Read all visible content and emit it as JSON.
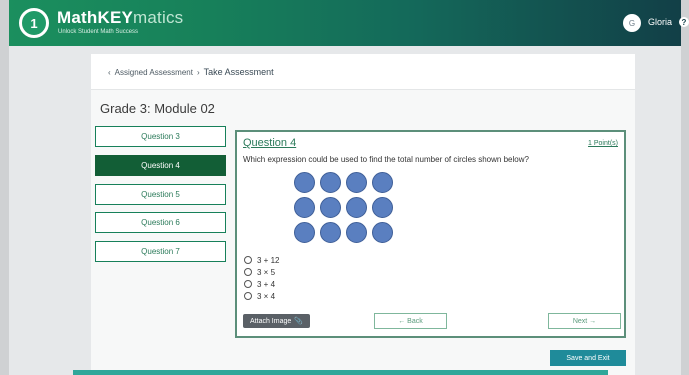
{
  "header": {
    "logo_letter": "1",
    "brand_bold": "MathKEY",
    "brand_light": "matics",
    "tagline": "Unlock Student Math Success",
    "user_initial": "G",
    "user_name": "Gloria",
    "help_glyph": "?"
  },
  "breadcrumb": {
    "back_glyph": "‹",
    "parent": "Assigned Assessment",
    "separator": "›",
    "current": "Take Assessment"
  },
  "module_title": "Grade 3: Module 02",
  "questions": [
    {
      "label": "Question 3",
      "active": false
    },
    {
      "label": "Question 4",
      "active": true
    },
    {
      "label": "Question 5",
      "active": false
    },
    {
      "label": "Question 6",
      "active": false
    },
    {
      "label": "Question 7",
      "active": false
    }
  ],
  "question": {
    "title": "Question 4",
    "points": "1 Point(s)",
    "text": "Which expression could be used to find the total number of circles shown below?",
    "circle_rows": 3,
    "circle_cols": 4,
    "options": [
      "3 + 12",
      "3 × 5",
      "3 + 4",
      "3 × 4"
    ]
  },
  "buttons": {
    "attach": "Attach Image",
    "attach_icon": "📎",
    "back": "← Back",
    "next": "Next →",
    "save_exit": "Save and Exit"
  },
  "colors": {
    "brand_green": "#17805a",
    "active_item": "#125e36",
    "circle_fill": "#5a7fc0",
    "save_button": "#1f8b9a"
  }
}
